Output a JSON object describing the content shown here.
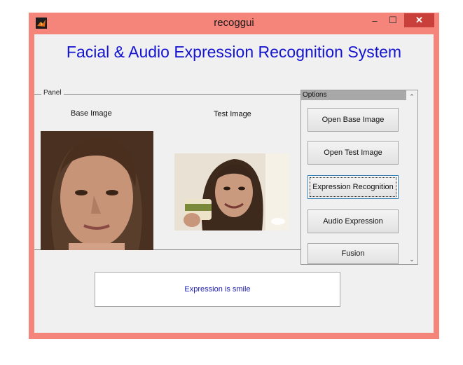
{
  "window": {
    "title": "recoggui",
    "minimize_glyph": "‒",
    "maximize_glyph": "☐",
    "close_glyph": "✕",
    "frame_color": "#f5847a",
    "close_color": "#c9403a"
  },
  "header": {
    "title": "Facial & Audio Expression Recognition System",
    "title_color": "#1414d0"
  },
  "panel": {
    "label": "Panel",
    "base_image_label": "Base Image",
    "test_image_label": "Test Image"
  },
  "options": {
    "label": "Options",
    "buttons": [
      {
        "label": "Open Base Image"
      },
      {
        "label": "Open Test Image"
      },
      {
        "label": "Expression Recognition",
        "focused": true
      },
      {
        "label": "Audio Expression"
      },
      {
        "label": "Fusion"
      }
    ],
    "scroll_up_glyph": "⌃",
    "scroll_down_glyph": "⌄"
  },
  "result": {
    "text": "Expression is smile",
    "text_color": "#1a1ab0"
  },
  "icons": {
    "app": "matlab-logo-icon"
  }
}
